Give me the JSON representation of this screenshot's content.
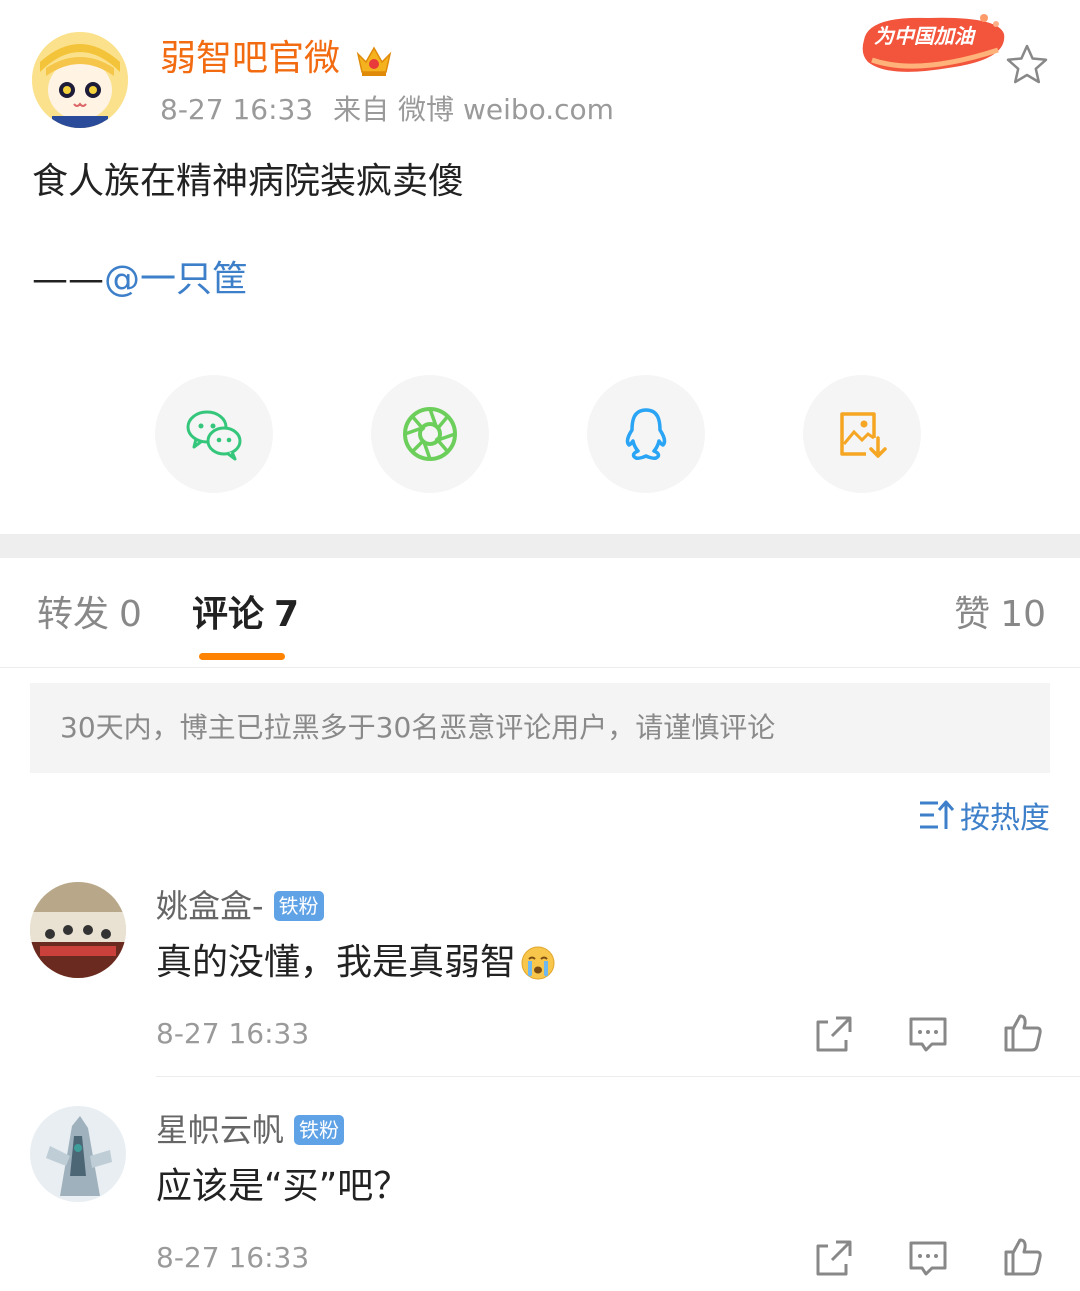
{
  "post": {
    "author": "弱智吧官微",
    "time": "8-27 16:33",
    "source": "来自 微博 weibo.com",
    "text": "食人族在精神病院装疯卖傻",
    "credit_dash": "——",
    "credit_user": "@一只筐",
    "promo_badge_text": "为中国加油"
  },
  "share": [
    {
      "name": "wechat-icon",
      "color": "#34c77b"
    },
    {
      "name": "moments-icon",
      "color": "#6dcf5b"
    },
    {
      "name": "qq-icon",
      "color": "#2aa4f4"
    },
    {
      "name": "save-image-icon",
      "color": "#f5a623"
    }
  ],
  "tabs": {
    "reposts_label": "转发",
    "reposts_count": "0",
    "comments_label": "评论",
    "comments_count": "7",
    "likes_label": "赞",
    "likes_count": "10"
  },
  "notice": "30天内，博主已拉黑多于30名恶意评论用户，请谨慎评论",
  "sort": {
    "label": "按热度"
  },
  "comments": [
    {
      "user": "姚盒盒-",
      "badge": "铁粉",
      "text": "真的没懂，我是真弱智",
      "emoji": "crying-face-icon",
      "time": "8-27 16:33"
    },
    {
      "user": "星帜云帆",
      "badge": "铁粉",
      "text": "应该是“买”吧？",
      "time": "8-27 16:33"
    }
  ],
  "colors": {
    "author": "#f26b10",
    "link": "#3d7fc9",
    "accent": "#ff8200",
    "badge": "#5fa2e6"
  }
}
